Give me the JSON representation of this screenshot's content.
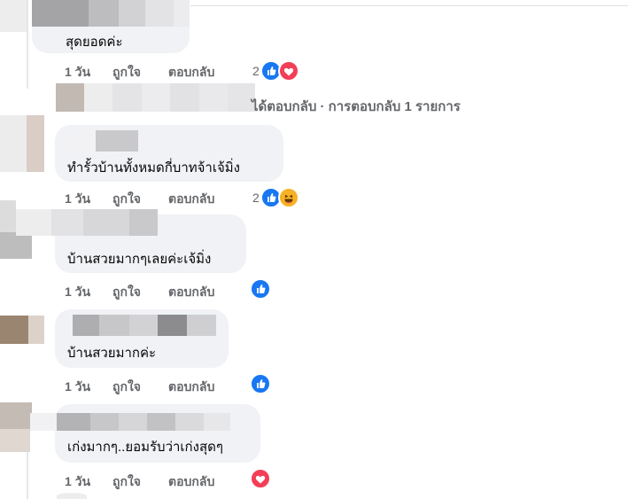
{
  "comments": [
    {
      "text": "สุดยอดค่ะ",
      "time": "1 วัน",
      "like": "ถูกใจ",
      "reply": "ตอบกลับ",
      "reaction_count": "2",
      "reactions": [
        "like",
        "love"
      ]
    },
    {
      "text": "ทำรั้วบ้านทั้งหมดกี่บาทจ้าเจ้มิ่ง",
      "time": "1 วัน",
      "like": "ถูกใจ",
      "reply": "ตอบกลับ",
      "reaction_count": "2",
      "reactions": [
        "like",
        "haha"
      ]
    },
    {
      "text": "บ้านสวยมากๆเลยค่ะเจ้มิ่ง",
      "time": "1 วัน",
      "like": "ถูกใจ",
      "reply": "ตอบกลับ",
      "reaction_count": "",
      "reactions": [
        "like"
      ]
    },
    {
      "text": "บ้านสวยมากค่ะ",
      "time": "1 วัน",
      "like": "ถูกใจ",
      "reply": "ตอบกลับ",
      "reaction_count": "",
      "reactions": [
        "like"
      ]
    },
    {
      "text": "เก่งมากๆ..ยอมรับว่าเก่งสุดๆ",
      "time": "1 วัน",
      "like": "ถูกใจ",
      "reply": "ตอบกลับ",
      "reaction_count": "",
      "reactions": [
        "love"
      ]
    }
  ],
  "reply_summary": "ได้ตอบกลับ · การตอบกลับ 1 รายการ",
  "colors": {
    "like": "#1877f2",
    "love": "#f33e58",
    "haha": "#f7b125",
    "bubble": "#f0f2f5",
    "meta": "#65676b"
  }
}
